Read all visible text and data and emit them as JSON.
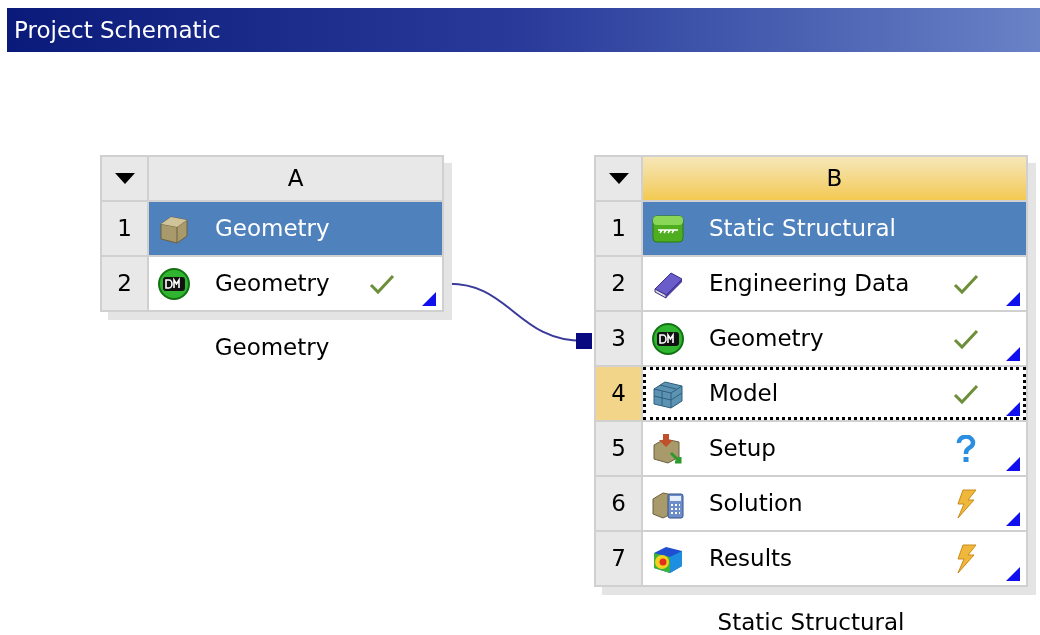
{
  "title": "Project Schematic",
  "systems": [
    {
      "column": "A",
      "selected": false,
      "caption": "Geometry",
      "rows": [
        {
          "number": "1",
          "label": "Geometry",
          "kind": "box",
          "header": true,
          "complete": false,
          "needs_input": false,
          "needs_update": false,
          "focused": false
        },
        {
          "number": "2",
          "label": "Geometry",
          "kind": "dm",
          "header": false,
          "complete": true,
          "needs_input": false,
          "needs_update": false,
          "focused": false
        }
      ]
    },
    {
      "column": "B",
      "selected": true,
      "caption": "Static Structural",
      "rows": [
        {
          "number": "1",
          "label": "Static Structural",
          "kind": "structural",
          "header": true,
          "complete": false,
          "needs_input": false,
          "needs_update": false,
          "focused": false
        },
        {
          "number": "2",
          "label": "Engineering Data",
          "kind": "book",
          "header": false,
          "complete": true,
          "needs_input": false,
          "needs_update": false,
          "focused": false
        },
        {
          "number": "3",
          "label": "Geometry",
          "kind": "dm",
          "header": false,
          "complete": true,
          "needs_input": false,
          "needs_update": false,
          "focused": false
        },
        {
          "number": "4",
          "label": "Model",
          "kind": "mesh",
          "header": false,
          "complete": true,
          "needs_input": false,
          "needs_update": false,
          "focused": true
        },
        {
          "number": "5",
          "label": "Setup",
          "kind": "setup",
          "header": false,
          "complete": false,
          "needs_input": true,
          "needs_update": false,
          "focused": false
        },
        {
          "number": "6",
          "label": "Solution",
          "kind": "solution",
          "header": false,
          "complete": false,
          "needs_input": false,
          "needs_update": true,
          "focused": false
        },
        {
          "number": "7",
          "label": "Results",
          "kind": "results",
          "header": false,
          "complete": false,
          "needs_input": false,
          "needs_update": true,
          "focused": false
        }
      ]
    }
  ]
}
